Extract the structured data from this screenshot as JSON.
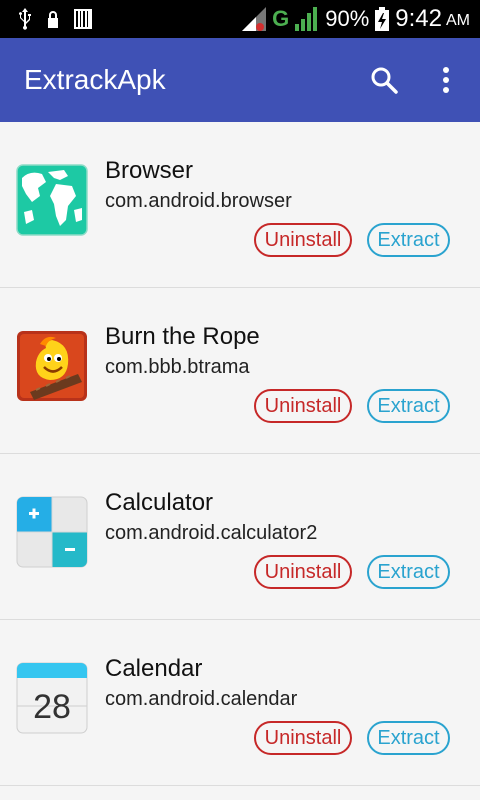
{
  "status_bar": {
    "network_type": "G",
    "battery_percent": "90%",
    "time": "9:42",
    "ampm": "AM"
  },
  "app_bar": {
    "title": "ExtrackApk"
  },
  "apps": [
    {
      "name": "Browser",
      "package": "com.android.browser",
      "icon": "browser-globe-icon"
    },
    {
      "name": "Burn the Rope",
      "package": "com.bbb.btrama",
      "icon": "burn-the-rope-icon"
    },
    {
      "name": "Calculator",
      "package": "com.android.calculator2",
      "icon": "calculator-icon"
    },
    {
      "name": "Calendar",
      "package": "com.android.calendar",
      "icon": "calendar-icon",
      "icon_text": "28"
    }
  ],
  "actions": {
    "uninstall_label": "Uninstall",
    "extract_label": "Extract"
  },
  "colors": {
    "app_bar": "#3f51b5",
    "uninstall": "#c62828",
    "extract": "#2aa3cf"
  }
}
